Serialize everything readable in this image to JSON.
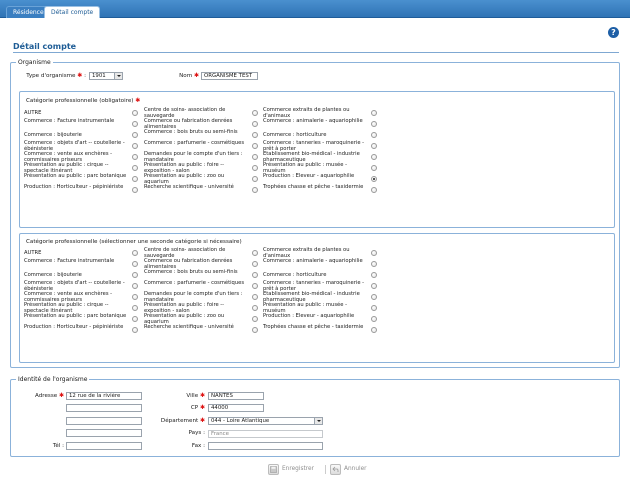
{
  "tabs": [
    {
      "label": "Résidence",
      "active": false
    },
    {
      "label": "Détail compte",
      "active": true
    }
  ],
  "page_title": "Détail compte",
  "help_icon": "?",
  "organisme": {
    "legend": "Organisme",
    "type_label": "Type d'organisme",
    "type_value": "1901",
    "nom_label": "Nom",
    "nom_value": "ORGANISME TEST"
  },
  "categories1": {
    "title": "Catégorie professionnelle (obligatoire)",
    "items": [
      "AUTRE",
      "Centre de soins- association de sauvegarde",
      "Commerce extraits de plantes ou d'animaux",
      "Commerce : Facture instrumentale",
      "Commerce ou fabrication denrées alimentaires",
      "Commerce : animalerie - aquariophilie",
      "Commerce : bijouterie",
      "Commerce : bois bruts ou semi-finis",
      "Commerce : horticulture",
      "Commerce : objets d'art -- coutellerie - ébénisterie",
      "Commerce : parfumerie - cosmétiques",
      "Commerce : tanneries - maroquinerie - prêt à porter",
      "Commerce : vente aux enchères - commissaires priseurs",
      "Demandes pour le compte d'un tiers : mandataire",
      "Etablissement bio-médical - industrie pharmaceutique",
      "Présentation au public : cirque -- spectacle itinérant",
      "Présentation au public : foire -- exposition - salon",
      "Présentation au public : musée - muséum",
      "Présentation au public : parc botanique",
      "Présentation au public : zoo ou aquarium",
      "Production : Eleveur - aquariophilie",
      "Production : Horticulteur - pépiniériste",
      "Recherche scientifique - université",
      "Trophées chasse et pêche - taxidermie"
    ],
    "selected": "Production : Eleveur - aquariophilie"
  },
  "categories2": {
    "title": "Catégorie professionnelle (sélectionner une seconde catégorie si nécessaire)",
    "items": [
      "AUTRE",
      "Centre de soins- association de sauvegarde",
      "Commerce extraits de plantes ou d'animaux",
      "Commerce : Facture instrumentale",
      "Commerce ou fabrication denrées alimentaires",
      "Commerce : animalerie - aquariophilie",
      "Commerce : bijouterie",
      "Commerce : bois bruts ou semi-finis",
      "Commerce : horticulture",
      "Commerce : objets d'art -- coutellerie - ébénisterie",
      "Commerce : parfumerie - cosmétiques",
      "Commerce : tanneries - maroquinerie - prêt à porter",
      "Commerce : vente aux enchères - commissaires priseurs",
      "Demandes pour le compte d'un tiers : mandataire",
      "Etablissement bio-médical - industrie pharmaceutique",
      "Présentation au public : cirque -- spectacle itinérant",
      "Présentation au public : foire -- exposition - salon",
      "Présentation au public : musée - muséum",
      "Présentation au public : parc botanique",
      "Présentation au public : zoo ou aquarium",
      "Production : Eleveur - aquariophilie",
      "Production : Horticulteur - pépiniériste",
      "Recherche scientifique - université",
      "Trophées chasse et pêche - taxidermie"
    ],
    "selected": ""
  },
  "identite": {
    "legend": "Identité de l'organisme",
    "adresse_label": "Adresse",
    "adresse_values": [
      "12 rue de la rivière",
      "",
      "",
      ""
    ],
    "tel_label": "Tél :",
    "tel_value": "",
    "ville_label": "Ville",
    "ville_value": "NANTES",
    "cp_label": "CP",
    "cp_value": "44000",
    "departement_label": "Département",
    "departement_value": "044 - Loire Atlantique",
    "pays_label": "Pays :",
    "pays_value": "France",
    "fax_label": "Fax :",
    "fax_value": ""
  },
  "buttons": {
    "save": "Enregistrer",
    "cancel": "Annuler"
  }
}
